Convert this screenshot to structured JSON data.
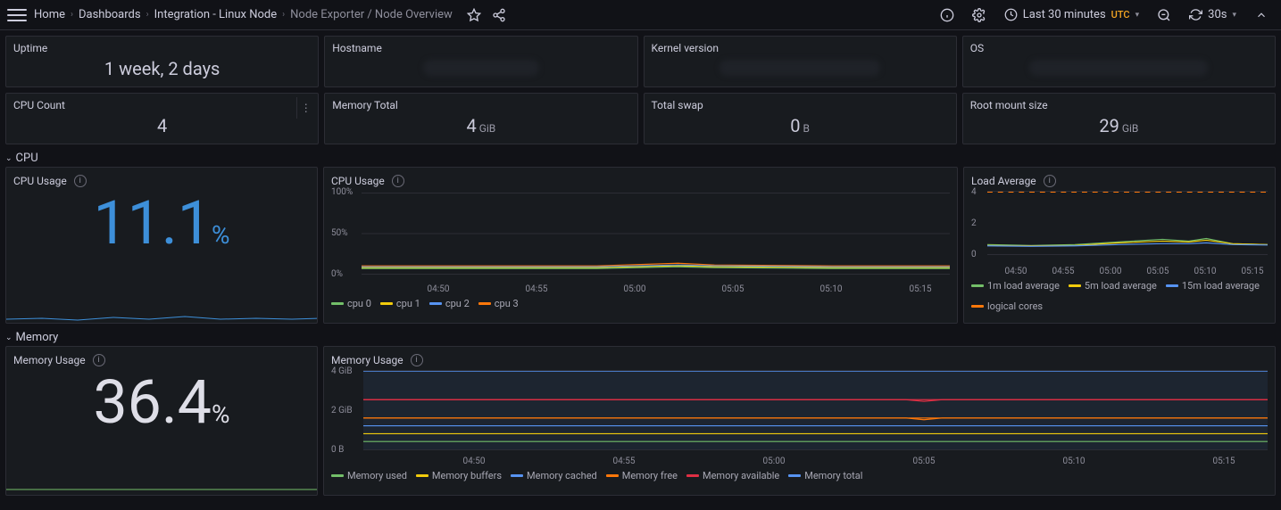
{
  "breadcrumbs": {
    "items": [
      "Home",
      "Dashboards",
      "Integration - Linux Node",
      "Node Exporter / Node Overview"
    ]
  },
  "topbar": {
    "time_range": "Last 30 minutes",
    "tz": "UTC",
    "refresh": "30s"
  },
  "stats": {
    "uptime": {
      "title": "Uptime",
      "value": "1 week, 2 days"
    },
    "hostname": {
      "title": "Hostname"
    },
    "kernel": {
      "title": "Kernel version"
    },
    "os": {
      "title": "OS"
    },
    "cpu_count": {
      "title": "CPU Count",
      "value": "4"
    },
    "mem_total": {
      "title": "Memory Total",
      "value": "4",
      "unit": "GiB"
    },
    "swap": {
      "title": "Total swap",
      "value": "0",
      "unit": "B"
    },
    "root": {
      "title": "Root mount size",
      "value": "29",
      "unit": "GiB"
    }
  },
  "sections": {
    "cpu": "CPU",
    "memory": "Memory"
  },
  "cpu_usage_stat": {
    "title": "CPU Usage",
    "value": "11.1",
    "unit": "%"
  },
  "cpu_usage_chart": {
    "title": "CPU Usage",
    "yticks": [
      "100%",
      "50%",
      "0%"
    ],
    "xticks": [
      "04:50",
      "04:55",
      "05:00",
      "05:05",
      "05:10",
      "05:15"
    ],
    "legend": [
      {
        "name": "cpu 0",
        "color": "#73bf69"
      },
      {
        "name": "cpu 1",
        "color": "#f2cc0c"
      },
      {
        "name": "cpu 2",
        "color": "#5794f2"
      },
      {
        "name": "cpu 3",
        "color": "#ff780a"
      }
    ]
  },
  "load_avg_chart": {
    "title": "Load Average",
    "yticks": [
      "4",
      "2",
      "0"
    ],
    "xticks": [
      "04:50",
      "04:55",
      "05:00",
      "05:05",
      "05:10",
      "05:15"
    ],
    "legend": [
      {
        "name": "1m load average",
        "color": "#73bf69"
      },
      {
        "name": "5m load average",
        "color": "#f2cc0c"
      },
      {
        "name": "15m load average",
        "color": "#5794f2"
      },
      {
        "name": "logical cores",
        "color": "#ff780a"
      }
    ]
  },
  "mem_usage_stat": {
    "title": "Memory Usage",
    "value": "36.4",
    "unit": "%"
  },
  "mem_usage_chart": {
    "title": "Memory Usage",
    "yticks": [
      "4 GiB",
      "2 GiB",
      "0 B"
    ],
    "xticks": [
      "04:50",
      "04:55",
      "05:00",
      "05:05",
      "05:10",
      "05:15"
    ],
    "legend": [
      {
        "name": "Memory used",
        "color": "#73bf69"
      },
      {
        "name": "Memory buffers",
        "color": "#f2cc0c"
      },
      {
        "name": "Memory cached",
        "color": "#5794f2"
      },
      {
        "name": "Memory free",
        "color": "#ff780a"
      },
      {
        "name": "Memory available",
        "color": "#e02f44"
      },
      {
        "name": "Memory total",
        "color": "#5794f2"
      }
    ]
  },
  "chart_data": [
    {
      "type": "line",
      "title": "CPU Usage",
      "xlabel": "",
      "ylabel": "",
      "ylim": [
        0,
        100
      ],
      "x": [
        "04:50",
        "04:55",
        "05:00",
        "05:05",
        "05:10",
        "05:15"
      ],
      "series": [
        {
          "name": "cpu 0",
          "color": "#73bf69",
          "values": [
            7,
            7,
            7,
            8,
            7,
            7
          ]
        },
        {
          "name": "cpu 1",
          "color": "#f2cc0c",
          "values": [
            8,
            8,
            8,
            9,
            8,
            8
          ]
        },
        {
          "name": "cpu 2",
          "color": "#5794f2",
          "values": [
            9,
            9,
            9,
            10,
            9,
            9
          ]
        },
        {
          "name": "cpu 3",
          "color": "#ff780a",
          "values": [
            10,
            10,
            10,
            12,
            10,
            10
          ]
        }
      ]
    },
    {
      "type": "line",
      "title": "Load Average",
      "xlabel": "",
      "ylabel": "",
      "ylim": [
        0,
        4
      ],
      "x": [
        "04:50",
        "04:55",
        "05:00",
        "05:05",
        "05:10",
        "05:15"
      ],
      "series": [
        {
          "name": "1m load average",
          "color": "#73bf69",
          "values": [
            0.6,
            0.5,
            0.6,
            0.9,
            0.8,
            0.6
          ]
        },
        {
          "name": "5m load average",
          "color": "#f2cc0c",
          "values": [
            0.6,
            0.55,
            0.6,
            0.8,
            0.75,
            0.65
          ]
        },
        {
          "name": "15m load average",
          "color": "#5794f2",
          "values": [
            0.6,
            0.58,
            0.6,
            0.7,
            0.7,
            0.65
          ]
        },
        {
          "name": "logical cores",
          "color": "#ff780a",
          "values": [
            4,
            4,
            4,
            4,
            4,
            4
          ],
          "dashed": true
        }
      ]
    },
    {
      "type": "area",
      "title": "Memory Usage",
      "xlabel": "",
      "ylabel": "",
      "ylim": [
        0,
        4
      ],
      "yunit": "GiB",
      "x": [
        "04:50",
        "04:55",
        "05:00",
        "05:05",
        "05:10",
        "05:15"
      ],
      "series": [
        {
          "name": "Memory used",
          "color": "#73bf69",
          "values": [
            0.4,
            0.4,
            0.4,
            0.4,
            0.4,
            0.4
          ]
        },
        {
          "name": "Memory buffers",
          "color": "#f2cc0c",
          "values": [
            0.8,
            0.8,
            0.8,
            0.8,
            0.8,
            0.8
          ]
        },
        {
          "name": "Memory cached",
          "color": "#5794f2",
          "values": [
            1.2,
            1.2,
            1.2,
            1.2,
            1.2,
            1.2
          ]
        },
        {
          "name": "Memory free",
          "color": "#ff780a",
          "values": [
            1.6,
            1.6,
            1.6,
            1.6,
            1.6,
            1.6
          ]
        },
        {
          "name": "Memory available",
          "color": "#e02f44",
          "values": [
            2.5,
            2.5,
            2.5,
            2.5,
            2.5,
            2.5
          ]
        },
        {
          "name": "Memory total",
          "color": "#5794f2",
          "values": [
            4,
            4,
            4,
            4,
            4,
            4
          ]
        }
      ]
    }
  ]
}
